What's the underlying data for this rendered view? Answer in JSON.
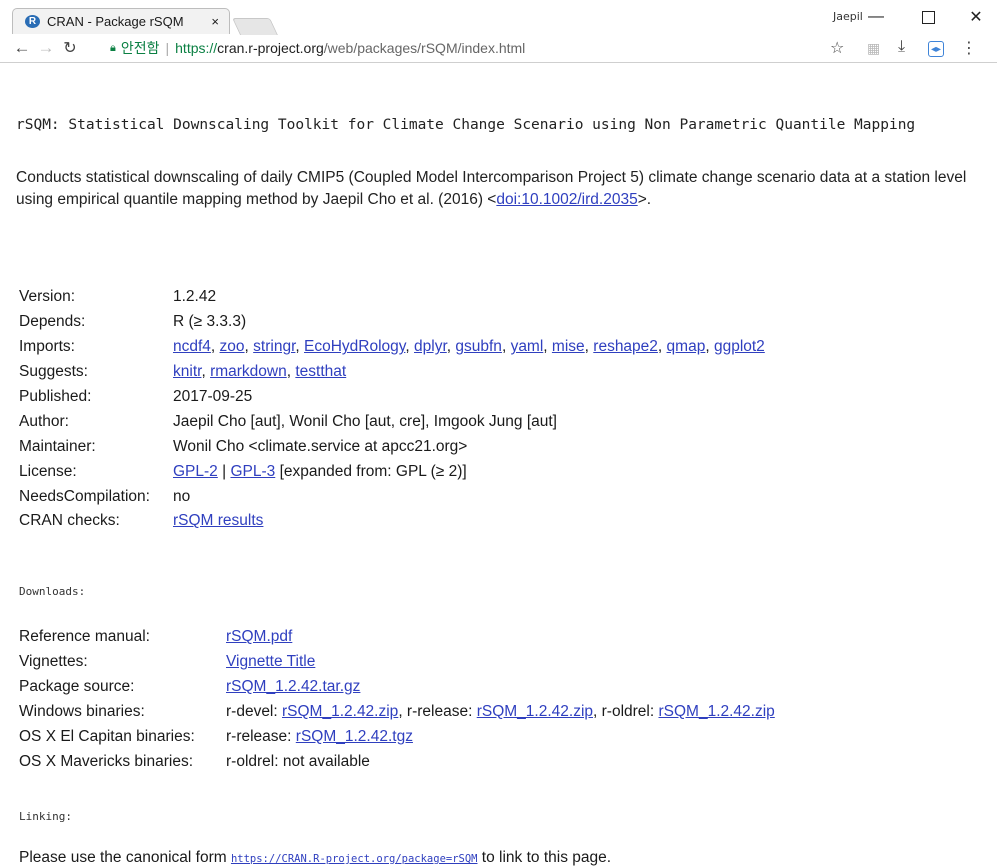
{
  "browser": {
    "tab_title": "CRAN - Package rSQM",
    "tab_close": "×",
    "favicon": "R",
    "profile": "Jaepil",
    "security_label": "안전함",
    "url_scheme": "https://",
    "url_host": "cran.r-project.org",
    "url_path": "/web/packages/rSQM/index.html"
  },
  "page": {
    "title": "rSQM: Statistical Downscaling Toolkit for Climate Change Scenario using Non Parametric Quantile Mapping",
    "description_text": "Conducts statistical downscaling of daily CMIP5 (Coupled Model Intercomparison Project 5) climate change scenario data at a station level using empirical quantile mapping method by Jaepil Cho et al. (2016) <",
    "description_doi": "doi:10.1002/ird.2035",
    "description_end": ">."
  },
  "meta": {
    "version": {
      "label": "Version:",
      "value": "1.2.42"
    },
    "depends": {
      "label": "Depends:",
      "value": "R (≥ 3.3.3)"
    },
    "imports": {
      "label": "Imports:",
      "links": [
        "ncdf4",
        "zoo",
        "stringr",
        "EcoHydRology",
        "dplyr",
        "gsubfn",
        "yaml",
        "mise",
        "reshape2",
        "qmap",
        "ggplot2"
      ]
    },
    "suggests": {
      "label": "Suggests:",
      "links": [
        "knitr",
        "rmarkdown",
        "testthat"
      ]
    },
    "published": {
      "label": "Published:",
      "value": "2017-09-25"
    },
    "author": {
      "label": "Author:",
      "value": "Jaepil Cho [aut], Wonil Cho [aut, cre], Imgook Jung [aut]"
    },
    "maintainer": {
      "label": "Maintainer:",
      "value": "Wonil Cho <climate.service at apcc21.org>"
    },
    "license": {
      "label": "License:",
      "link1": "GPL-2",
      "sep": " | ",
      "link2": "GPL-3",
      "rest": " [expanded from: GPL (≥ 2)]"
    },
    "needs": {
      "label": "NeedsCompilation:",
      "value": "no"
    },
    "checks": {
      "label": "CRAN checks:",
      "link": "rSQM results"
    }
  },
  "downloads": {
    "heading": "Downloads:",
    "reference": {
      "label": "Reference manual:",
      "link": "rSQM.pdf"
    },
    "vignettes": {
      "label": "Vignettes:",
      "link": "Vignette Title"
    },
    "source": {
      "label": "Package source:",
      "link": "rSQM_1.2.42.tar.gz"
    },
    "windows": {
      "label": "Windows binaries:",
      "p1": "r-devel: ",
      "l1": "rSQM_1.2.42.zip",
      "p2": ", r-release: ",
      "l2": "rSQM_1.2.42.zip",
      "p3": ", r-oldrel: ",
      "l3": "rSQM_1.2.42.zip"
    },
    "osx_capitan": {
      "label": "OS X El Capitan binaries:",
      "prefix": "r-release: ",
      "link": "rSQM_1.2.42.tgz"
    },
    "osx_mavericks": {
      "label": "OS X Mavericks binaries:",
      "value": "r-oldrel: not available"
    }
  },
  "linking": {
    "heading": "Linking:",
    "text_before": "Please use the canonical form ",
    "link": "https://CRAN.R-project.org/package=rSQM",
    "text_after": " to link to this page."
  }
}
